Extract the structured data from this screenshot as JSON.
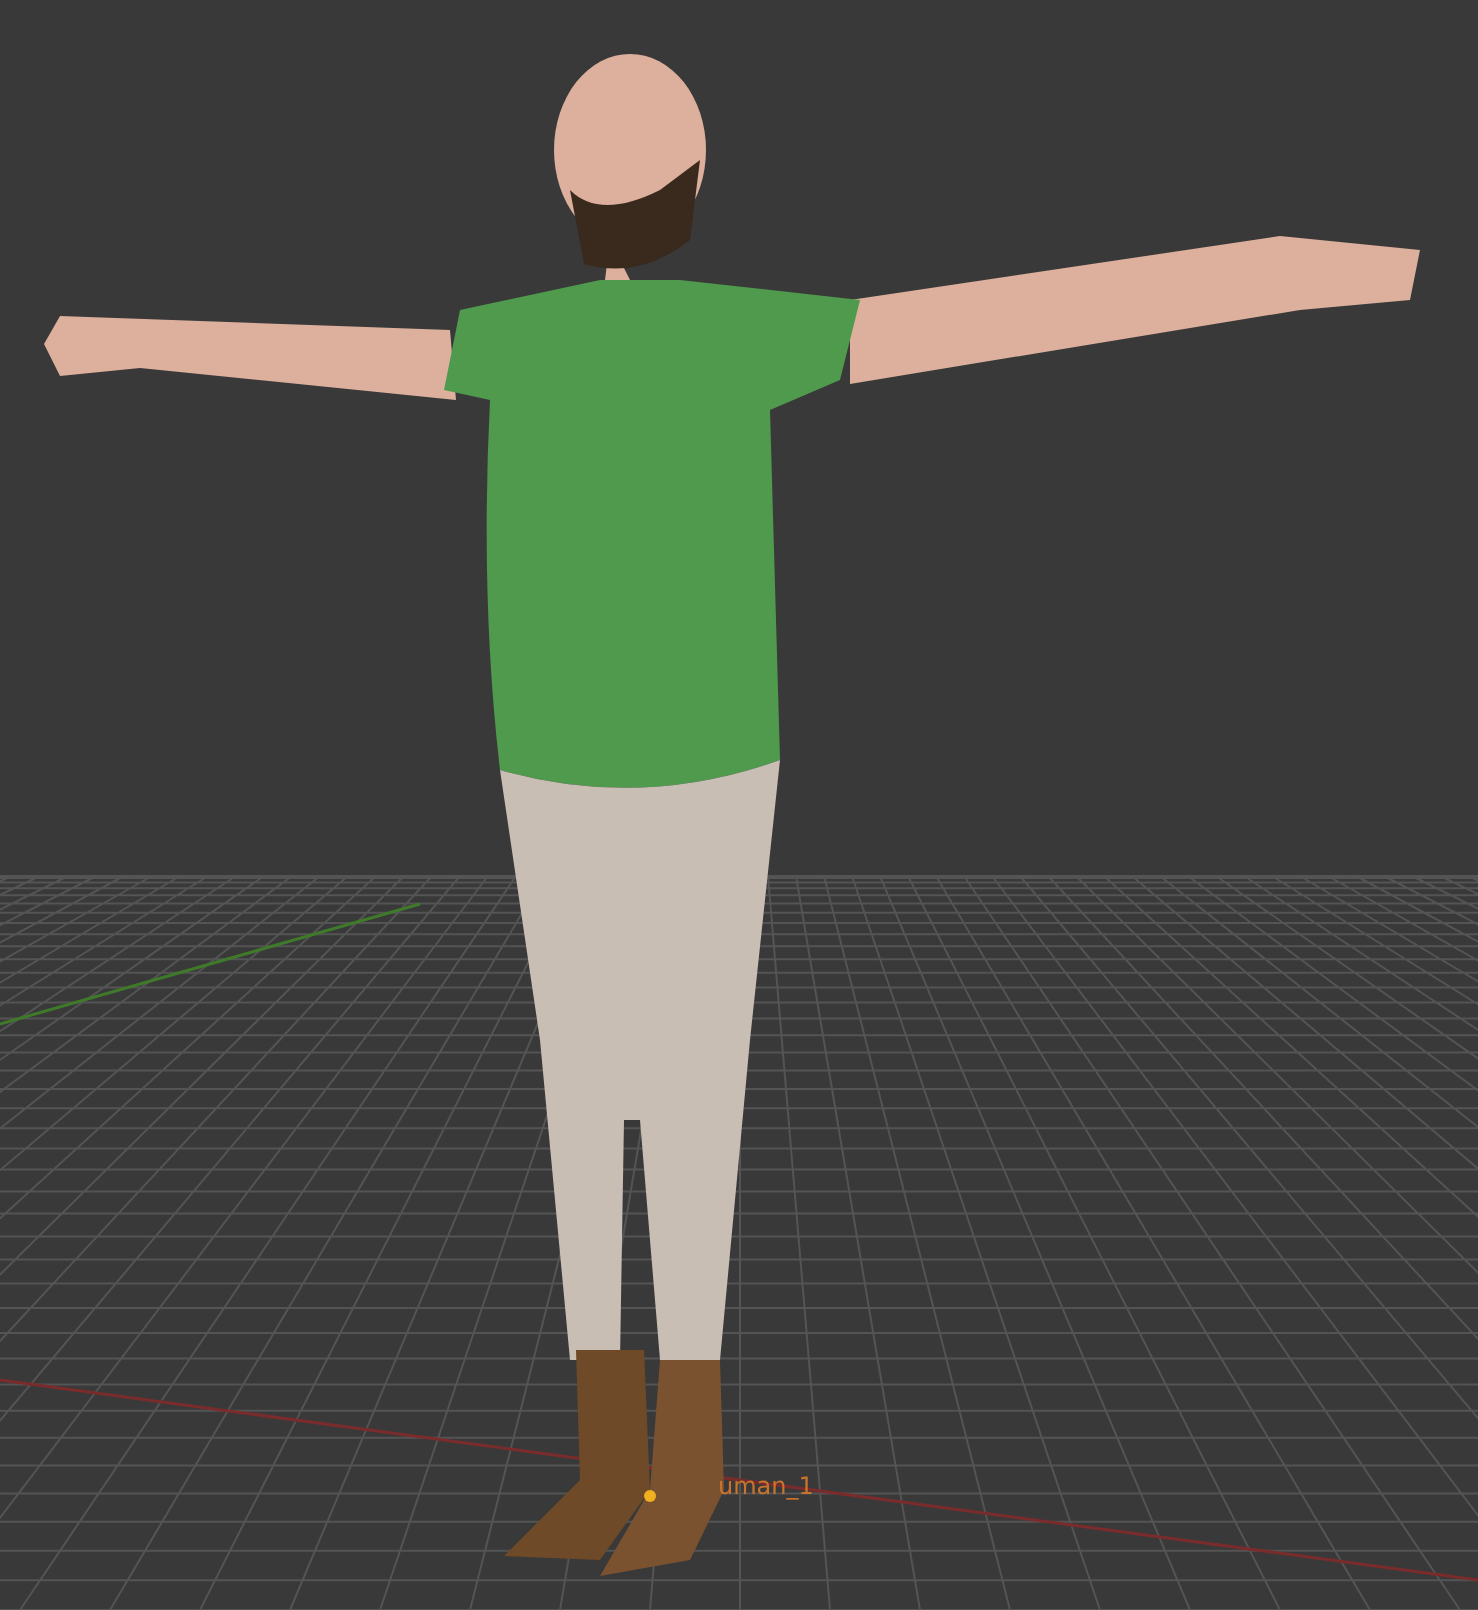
{
  "viewport": {
    "object_label": "uman_1"
  }
}
